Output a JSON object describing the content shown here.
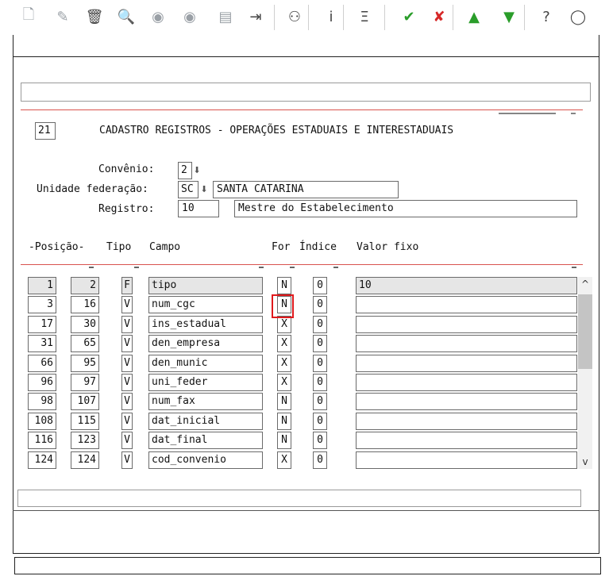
{
  "form": {
    "code": "21",
    "title": "CADASTRO REGISTROS - OPERAÇÕES ESTADUAIS E INTERESTADUAIS",
    "convenio_label": "Convênio:",
    "convenio_value": "2",
    "uf_label": "Unidade federação:",
    "uf_value": "SC",
    "uf_name": "SANTA CATARINA",
    "registro_label": "Registro:",
    "registro_value": "10",
    "registro_desc": "Mestre do Estabelecimento"
  },
  "table": {
    "headers": {
      "posicao": "-Posição-",
      "tipo": "Tipo",
      "campo": "Campo",
      "for": "For",
      "indice": "Índice",
      "valor": "Valor fixo"
    },
    "rows": [
      {
        "ini": "1",
        "fim": "2",
        "tipo": "F",
        "campo": "tipo",
        "for": "N",
        "indice": "0",
        "valor": "10"
      },
      {
        "ini": "3",
        "fim": "16",
        "tipo": "V",
        "campo": "num_cgc",
        "for": "N",
        "indice": "0",
        "valor": ""
      },
      {
        "ini": "17",
        "fim": "30",
        "tipo": "V",
        "campo": "ins_estadual",
        "for": "X",
        "indice": "0",
        "valor": ""
      },
      {
        "ini": "31",
        "fim": "65",
        "tipo": "V",
        "campo": "den_empresa",
        "for": "X",
        "indice": "0",
        "valor": ""
      },
      {
        "ini": "66",
        "fim": "95",
        "tipo": "V",
        "campo": "den_munic",
        "for": "X",
        "indice": "0",
        "valor": ""
      },
      {
        "ini": "96",
        "fim": "97",
        "tipo": "V",
        "campo": "uni_feder",
        "for": "X",
        "indice": "0",
        "valor": ""
      },
      {
        "ini": "98",
        "fim": "107",
        "tipo": "V",
        "campo": "num_fax",
        "for": "N",
        "indice": "0",
        "valor": ""
      },
      {
        "ini": "108",
        "fim": "115",
        "tipo": "V",
        "campo": "dat_inicial",
        "for": "N",
        "indice": "0",
        "valor": ""
      },
      {
        "ini": "116",
        "fim": "123",
        "tipo": "V",
        "campo": "dat_final",
        "for": "N",
        "indice": "0",
        "valor": ""
      },
      {
        "ini": "124",
        "fim": "124",
        "tipo": "V",
        "campo": "cod_convenio",
        "for": "X",
        "indice": "0",
        "valor": ""
      }
    ]
  },
  "toolbar": {
    "icons": [
      "new-doc-icon",
      "edit-icon",
      "trash-icon",
      "search-icon",
      "previous-icon",
      "next-icon",
      "print-icon",
      "exit-icon",
      "binoculars-icon",
      "info-icon",
      "zoom-icon",
      "confirm-icon",
      "cancel-icon",
      "up-icon",
      "down-icon",
      "help-icon",
      "chat-icon"
    ],
    "glyphs": {
      "new-doc-icon": "🗋",
      "edit-icon": "✎",
      "trash-icon": "🗑",
      "search-icon": "🔍",
      "previous-icon": "◉",
      "next-icon": "◉",
      "print-icon": "▤",
      "exit-icon": "⇥",
      "binoculars-icon": "⚇",
      "info-icon": "i",
      "zoom-icon": "Ξ",
      "confirm-icon": "✔",
      "cancel-icon": "✘",
      "up-icon": "▲",
      "down-icon": "▼",
      "help-icon": "?",
      "chat-icon": "◯"
    }
  },
  "colors": {
    "accent_red": "#d9534f",
    "confirm_green": "#2a9d2a",
    "cancel_red": "#d62828",
    "highlight": "#e0191c"
  }
}
